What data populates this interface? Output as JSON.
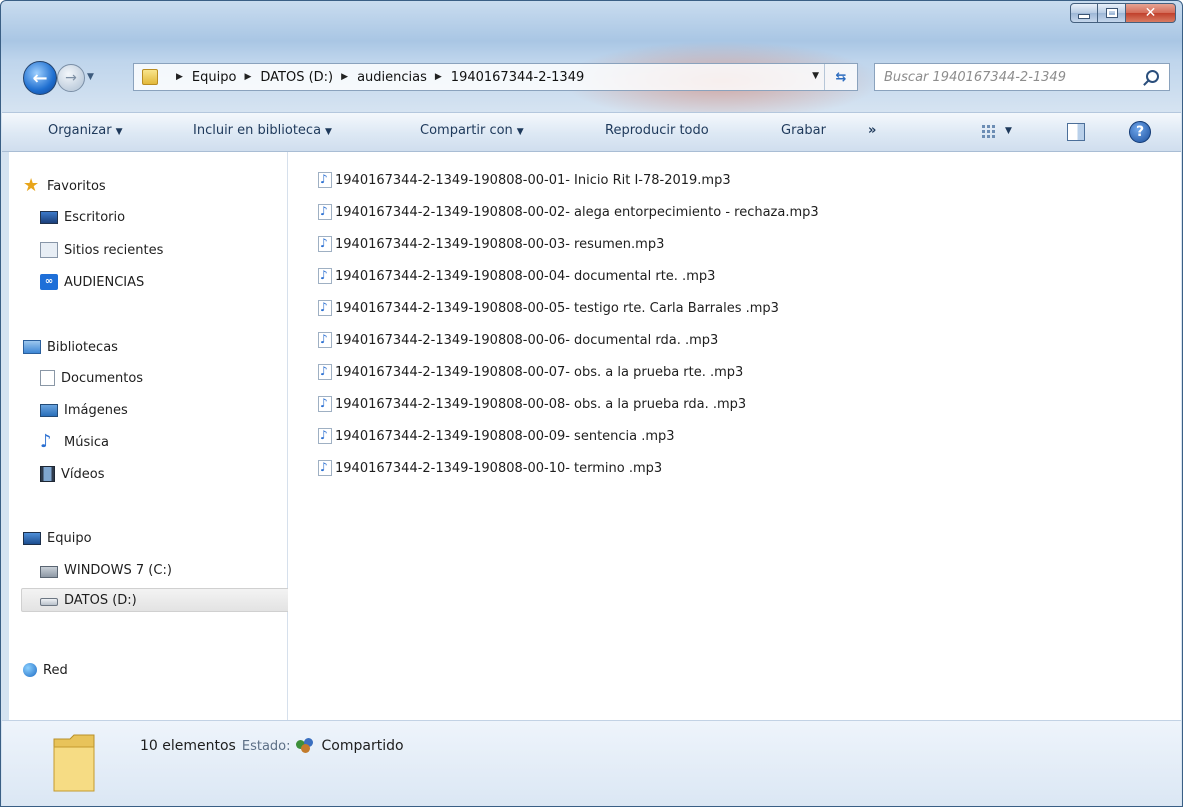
{
  "breadcrumb": [
    "Equipo",
    "DATOS (D:)",
    "audiencias",
    "1940167344-2-1349"
  ],
  "search": {
    "placeholder": "Buscar 1940167344-2-1349"
  },
  "toolbar": {
    "organize": "Organizar",
    "include_library": "Incluir en biblioteca",
    "share_with": "Compartir con",
    "play_all": "Reproducir todo",
    "burn": "Grabar",
    "more": "»"
  },
  "sidebar": {
    "favorites": {
      "header": "Favoritos",
      "items": [
        "Escritorio",
        "Sitios recientes",
        "AUDIENCIAS"
      ]
    },
    "libraries": {
      "header": "Bibliotecas",
      "items": [
        "Documentos",
        "Imágenes",
        "Música",
        "Vídeos"
      ]
    },
    "computer": {
      "header": "Equipo",
      "items": [
        "WINDOWS 7 (C:)",
        "DATOS (D:)"
      ],
      "selected": "DATOS (D:)"
    },
    "network": {
      "header": "Red"
    }
  },
  "files": [
    "1940167344-2-1349-190808-00-01- Inicio Rit I-78-2019.mp3",
    "1940167344-2-1349-190808-00-02- alega entorpecimiento - rechaza.mp3",
    "1940167344-2-1349-190808-00-03- resumen.mp3",
    "1940167344-2-1349-190808-00-04- documental rte. .mp3",
    "1940167344-2-1349-190808-00-05- testigo rte. Carla Barrales .mp3",
    "1940167344-2-1349-190808-00-06- documental rda. .mp3",
    "1940167344-2-1349-190808-00-07- obs. a la prueba rte. .mp3",
    "1940167344-2-1349-190808-00-08- obs. a la prueba rda. .mp3",
    "1940167344-2-1349-190808-00-09- sentencia .mp3",
    "1940167344-2-1349-190808-00-10- termino .mp3"
  ],
  "details": {
    "count": "10 elementos",
    "state_label": "Estado:",
    "state_value": "Compartido"
  },
  "colors": {
    "window_frame": "#a9c6e4",
    "toolbar_text": "#1e395b",
    "close_button": "#c0402c",
    "selected_nav": "#e3e3e3"
  }
}
